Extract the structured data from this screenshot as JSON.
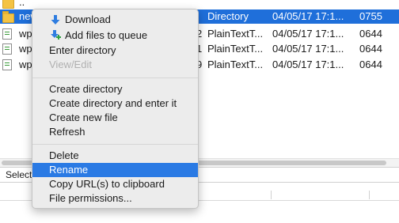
{
  "file_list": {
    "rows": [
      {
        "name": "..",
        "size": "",
        "type": "",
        "modified": "",
        "permissions": "",
        "icon": "folder-icon",
        "selected": false
      },
      {
        "name": "new",
        "size": "",
        "type": "Directory",
        "modified": "04/05/17 17:1...",
        "permissions": "0755",
        "icon": "folder-icon",
        "selected": true
      },
      {
        "name": "wp",
        "size": "2",
        "type": "PlainTextT...",
        "modified": "04/05/17 17:1...",
        "permissions": "0644",
        "icon": "document-icon",
        "selected": false
      },
      {
        "name": "wp",
        "size": "1",
        "type": "PlainTextT...",
        "modified": "04/05/17 17:1...",
        "permissions": "0644",
        "icon": "document-icon",
        "selected": false
      },
      {
        "name": "wp",
        "size": "9",
        "type": "PlainTextT...",
        "modified": "04/05/17 17:1...",
        "permissions": "0644",
        "icon": "document-icon",
        "selected": false
      }
    ]
  },
  "status_bar": {
    "text": "Selecte"
  },
  "context_menu": {
    "download": {
      "label": "Download",
      "icon": "download-arrow-icon"
    },
    "add_to_queue": {
      "label": "Add files to queue",
      "icon": "add-to-queue-icon"
    },
    "enter_directory": {
      "label": "Enter directory"
    },
    "view_edit": {
      "label": "View/Edit",
      "disabled": true
    },
    "create_directory": {
      "label": "Create directory"
    },
    "create_directory_enter": {
      "label": "Create directory and enter it"
    },
    "create_new_file": {
      "label": "Create new file"
    },
    "refresh": {
      "label": "Refresh"
    },
    "delete": {
      "label": "Delete"
    },
    "rename": {
      "label": "Rename",
      "highlighted": true
    },
    "copy_url": {
      "label": "Copy URL(s) to clipboard"
    },
    "file_permissions": {
      "label": "File permissions..."
    }
  },
  "colors": {
    "selection": "#1f6fda",
    "menu_highlight": "#2a7ae4",
    "menu_background": "#ececec",
    "folder": "#f4c344",
    "download_arrow": "#2f7de0",
    "add_plus": "#2ea043"
  }
}
